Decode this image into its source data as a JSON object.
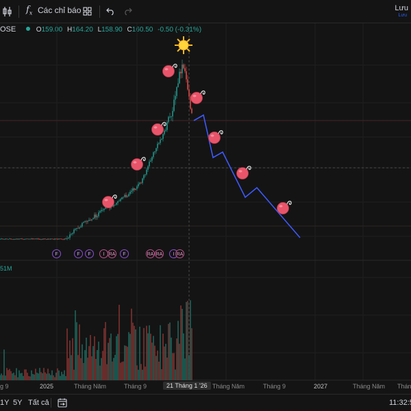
{
  "toolbar": {
    "indicators_label": "Các chỉ báo",
    "right_title": "Lưu",
    "right_subtitle": "Lưu"
  },
  "legend": {
    "symbol_tail": "OSE",
    "open_label": "O",
    "open": "159.00",
    "high_label": "H",
    "high": "164.20",
    "low_label": "L",
    "low": "158.90",
    "close_label": "C",
    "close": "160.50",
    "change": "-0.50 (-0.31%)"
  },
  "volume_label": "51M",
  "x_axis": {
    "labels": [
      "g 9",
      "2025",
      "Tháng Năm",
      "Tháng 9",
      "Tháng Năm",
      "Tháng 9",
      "2027",
      "Tháng Năm",
      "Tháng"
    ],
    "current": "21 Tháng 1 '26"
  },
  "badges": [
    "F",
    "F",
    "F",
    "I",
    "RA",
    "F",
    "RA",
    "RA",
    "I",
    "RA"
  ],
  "bottom": {
    "range_1y": "1Y",
    "range_5y": "5Y",
    "range_all": "Tất cả",
    "clock": "11:32:5"
  },
  "colors": {
    "up": "#26a69a",
    "down": "#ef5350",
    "projection": "#3d5afe",
    "background": "#141414"
  },
  "icons": [
    "bar-chart-icon",
    "fx-icon",
    "layout-grid-icon",
    "undo-icon",
    "redo-icon",
    "calendar-range-icon",
    "sun-icon",
    "apple-icon"
  ]
}
